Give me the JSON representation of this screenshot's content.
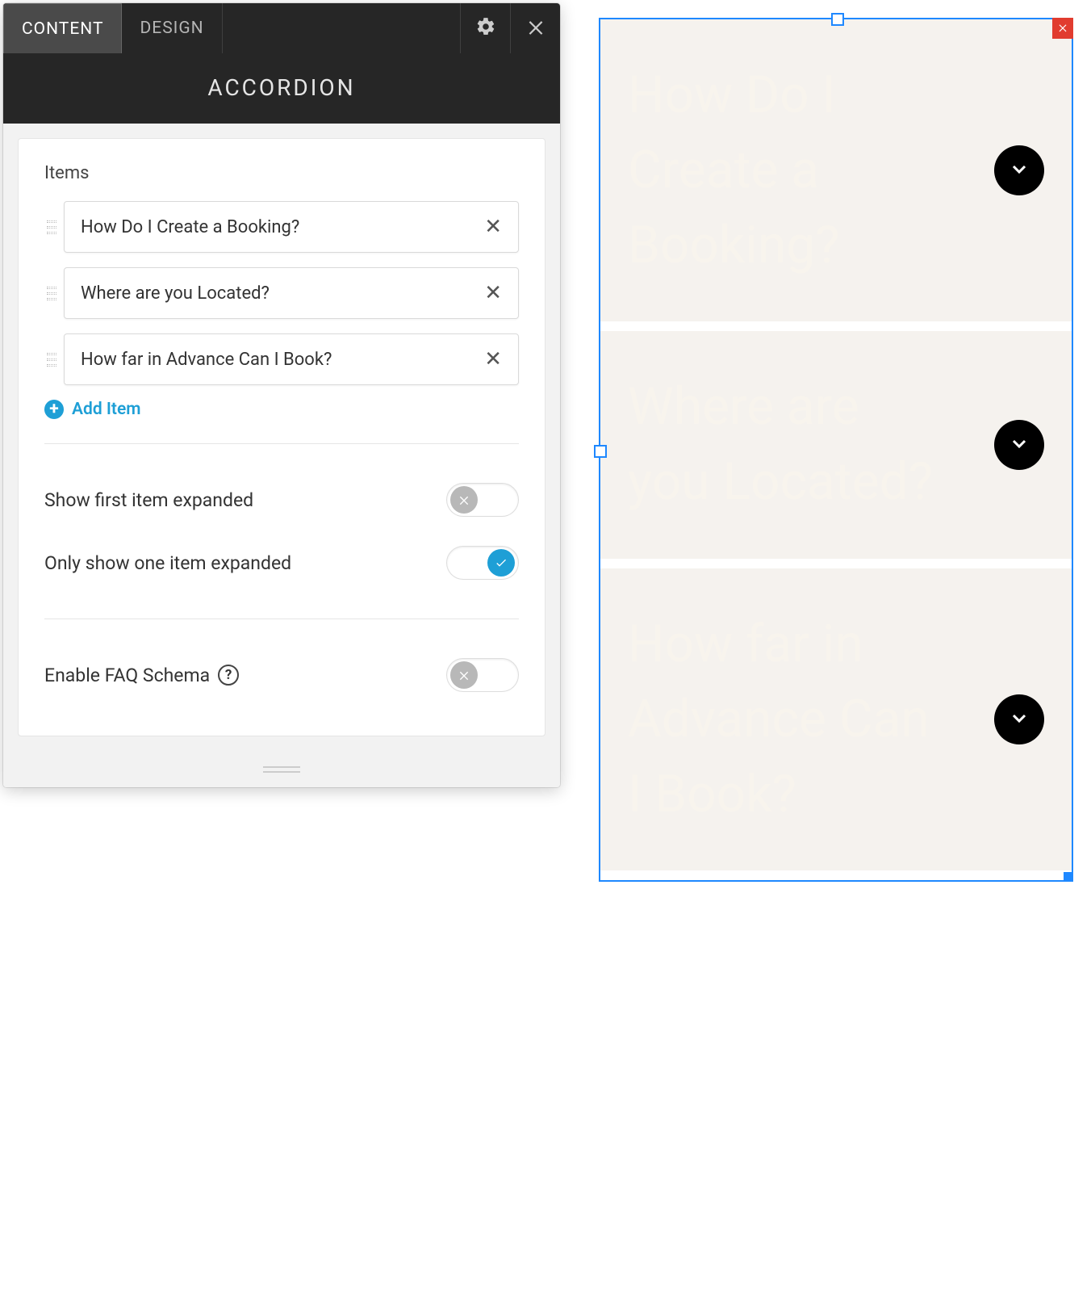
{
  "panel": {
    "tabs": {
      "content": "CONTENT",
      "design": "DESIGN"
    },
    "title": "ACCORDION",
    "items_label": "Items",
    "items": [
      {
        "title": "How Do I Create a Booking?"
      },
      {
        "title": "Where are you Located?"
      },
      {
        "title": "How far in Advance Can I Book?"
      }
    ],
    "add_item_label": "Add Item",
    "toggles": {
      "first_expanded": {
        "label": "Show first item expanded",
        "value": false
      },
      "one_expanded": {
        "label": "Only show one item expanded",
        "value": true
      },
      "faq_schema": {
        "label": "Enable FAQ Schema",
        "value": false
      }
    }
  },
  "preview": {
    "items": [
      {
        "title": "How Do I Create a Booking?"
      },
      {
        "title": "Where are you Located?"
      },
      {
        "title": "How far in Advance Can I Book?"
      }
    ]
  }
}
